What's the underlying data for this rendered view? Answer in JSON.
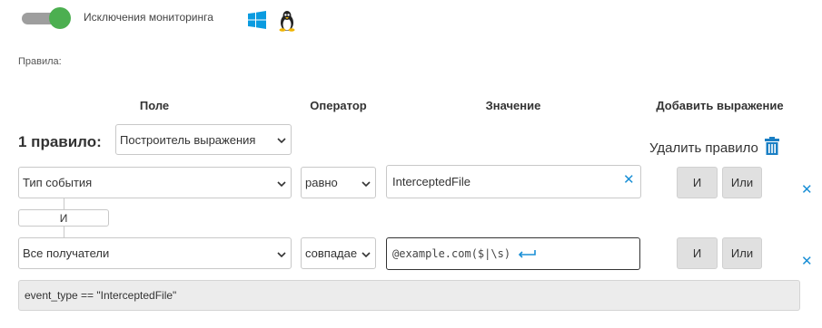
{
  "monitoring": {
    "toggle_on": true,
    "label": "Исключения мониторинга",
    "os_icons": [
      "windows-icon",
      "linux-icon"
    ]
  },
  "rules_label": "Правила:",
  "headers": {
    "field": "Поле",
    "operator": "Оператор",
    "value": "Значение",
    "add_expression": "Добавить выражение"
  },
  "rule": {
    "number_label": "1 правило:",
    "mode_selected": "Построитель выражения",
    "delete_label": "Удалить правило",
    "conditions": [
      {
        "field": "Тип события",
        "operator": "равно",
        "value": "InterceptedFile",
        "and_label": "И",
        "or_label": "Или"
      },
      {
        "field": "Все получатели",
        "operator": "совпадае",
        "value": "@example.com($|\\s)",
        "and_label": "И",
        "or_label": "Или"
      }
    ],
    "connector": "И",
    "expression": "event_type == \"InterceptedFile\""
  },
  "colors": {
    "toggle_on": "#4caf50",
    "accent": "#1a8fd6",
    "button_bg": "#e0e0e0"
  }
}
